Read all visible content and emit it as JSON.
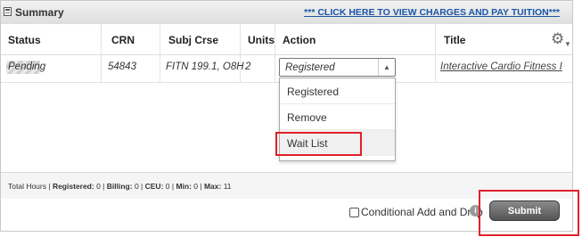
{
  "header": {
    "title": "Summary",
    "charges_link": "*** CLICK HERE TO VIEW CHARGES AND PAY TUITION***"
  },
  "columns": [
    "Status",
    "CRN",
    "Subj Crse",
    "Units",
    "Action",
    "Title"
  ],
  "row": {
    "status": "Pending",
    "crn": "54843",
    "subj_crse": "FITN 199.1, O8H",
    "units": "2",
    "action": "Registered",
    "title": "Interactive Cardio Fitness I"
  },
  "action_dropdown": {
    "options": [
      "Registered",
      "Remove",
      "Wait List"
    ],
    "highlighted": "Wait List"
  },
  "totals": {
    "total_hours_label": "Total Hours",
    "registered_label": "Registered:",
    "registered": "0",
    "billing_label": "Billing:",
    "billing": "0",
    "ceu_label": "CEU:",
    "ceu": "0",
    "min_label": "Min:",
    "min": "0",
    "max_label": "Max:",
    "max": "11"
  },
  "footer": {
    "conditional_label": "Conditional Add and Drop",
    "submit_label": "Submit"
  },
  "icons": {
    "header": "summary-table-icon",
    "settings": "gear-icon",
    "info": "info-icon"
  },
  "colors": {
    "link": "#1a57a8",
    "annotation": "#e0202a",
    "submit": "#5a5a5a"
  }
}
